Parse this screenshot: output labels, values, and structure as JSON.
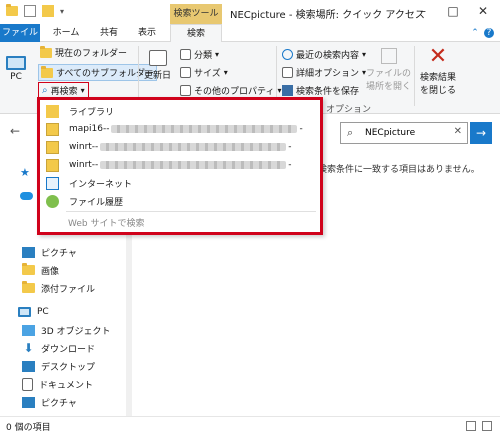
{
  "title_bar": {
    "contextual_tab": "検索ツール",
    "window_title": "NECpicture - 検索場所: クイック アクセス"
  },
  "tabs": [
    {
      "label": "ファイル"
    },
    {
      "label": "ホーム"
    },
    {
      "label": "共有"
    },
    {
      "label": "表示"
    },
    {
      "label": "検索"
    }
  ],
  "ribbon": {
    "current_folder": "現在のフォルダー",
    "all_subfolders": "すべてのサブフォルダー",
    "research": "再検索",
    "pc": "PC",
    "modified_date": "更新日",
    "kind": "分類",
    "size": "サイズ",
    "other_properties": "その他のプロパティ",
    "recent_searches": "最近の検索内容",
    "advanced_options": "詳細オプション",
    "save_search": "検索条件を保存",
    "options_group": "オプション",
    "open_file_location": "ファイルの\n場所を開く",
    "close_search": "検索結果\nを閉じる"
  },
  "search": {
    "value": "NECpicture"
  },
  "empty_message": "検索条件に一致する項目はありません。",
  "left_pane": {
    "items": [
      {
        "label": "ピクチャ"
      },
      {
        "label": "画像"
      },
      {
        "label": "添付ファイル"
      },
      {
        "label": "PC"
      },
      {
        "label": "3D オブジェクト"
      },
      {
        "label": "ダウンロード"
      },
      {
        "label": "デスクトップ"
      },
      {
        "label": "ドキュメント"
      },
      {
        "label": "ピクチャ"
      }
    ]
  },
  "dropdown": {
    "items": [
      {
        "label": "ライブラリ",
        "suffix": ""
      },
      {
        "label": "mapi16--",
        "suffix": "-"
      },
      {
        "label": "winrt--",
        "suffix": "-"
      },
      {
        "label": "winrt--",
        "suffix": "-"
      },
      {
        "label": "インターネット",
        "suffix": ""
      },
      {
        "label": "ファイル履歴",
        "suffix": ""
      }
    ],
    "web_search": "Web サイトで検索"
  },
  "status": {
    "item_count": "0 個の項目"
  },
  "colors": {
    "accent": "#1979ca",
    "highlight_border": "#d0021b",
    "contextual_tab": "#e8c871"
  }
}
